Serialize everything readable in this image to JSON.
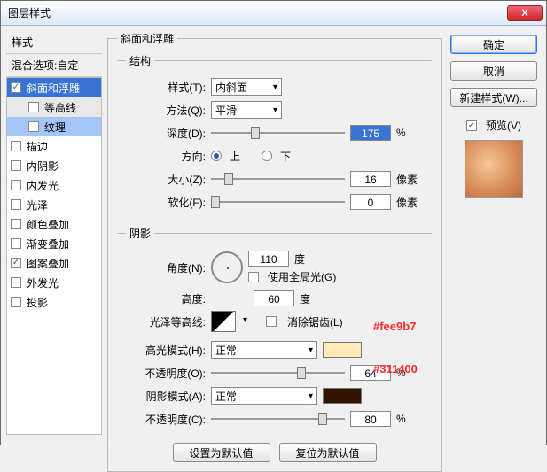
{
  "window": {
    "title": "图层样式"
  },
  "closeGlyph": "X",
  "left": {
    "heading": "样式",
    "blend": "混合选项:自定",
    "items": [
      {
        "key": "bevel",
        "label": "斜面和浮雕",
        "checked": true,
        "selected": true
      },
      {
        "key": "contour",
        "label": "等高线",
        "checked": false,
        "sub": true
      },
      {
        "key": "texture",
        "label": "纹理",
        "checked": false,
        "sub": true,
        "subsel": true
      },
      {
        "key": "stroke",
        "label": "描边",
        "checked": false
      },
      {
        "key": "innerShadow",
        "label": "内阴影",
        "checked": false
      },
      {
        "key": "innerGlow",
        "label": "内发光",
        "checked": false
      },
      {
        "key": "gloss",
        "label": "光泽",
        "checked": false
      },
      {
        "key": "colorOverlay",
        "label": "颜色叠加",
        "checked": false
      },
      {
        "key": "gradOverlay",
        "label": "渐变叠加",
        "checked": false
      },
      {
        "key": "pattOverlay",
        "label": "图案叠加",
        "checked": true
      },
      {
        "key": "outerGlow",
        "label": "外发光",
        "checked": false
      },
      {
        "key": "dropShadow",
        "label": "投影",
        "checked": false
      }
    ]
  },
  "bevel": {
    "groupTitle": "斜面和浮雕",
    "structTitle": "结构",
    "styleLabel": "样式(T):",
    "styleValue": "内斜面",
    "techLabel": "方法(Q):",
    "techValue": "平滑",
    "depthLabel": "深度(D):",
    "depthValue": "175",
    "depthUnit": "%",
    "dirLabel": "方向:",
    "dirUp": "上",
    "dirDown": "下",
    "sizeLabel": "大小(Z):",
    "sizeValue": "16",
    "sizeUnit": "像素",
    "softLabel": "软化(F):",
    "softValue": "0",
    "softUnit": "像素"
  },
  "shade": {
    "title": "阴影",
    "angleLabel": "角度(N):",
    "angleValue": "110",
    "angleUnit": "度",
    "globalLabel": "使用全局光(G)",
    "altLabel": "高度:",
    "altValue": "60",
    "altUnit": "度",
    "glossLabel": "光泽等高线:",
    "aaLabel": "消除锯齿(L)",
    "hiLabel": "高光模式(H):",
    "hiMode": "正常",
    "hiColor": "#fee9b7",
    "hiOpLabel": "不透明度(O):",
    "hiOpValue": "64",
    "hiOpUnit": "%",
    "shLabel": "阴影模式(A):",
    "shMode": "正常",
    "shColor": "#311400",
    "shOpLabel": "不透明度(C):",
    "shOpValue": "80",
    "shOpUnit": "%"
  },
  "bottom": {
    "default": "设置为默认值",
    "reset": "复位为默认值"
  },
  "right": {
    "ok": "确定",
    "cancel": "取消",
    "newStyle": "新建样式(W)...",
    "previewLabel": "预览(V)"
  },
  "anno": {
    "hi": "#fee9b7",
    "sh": "#311400"
  }
}
